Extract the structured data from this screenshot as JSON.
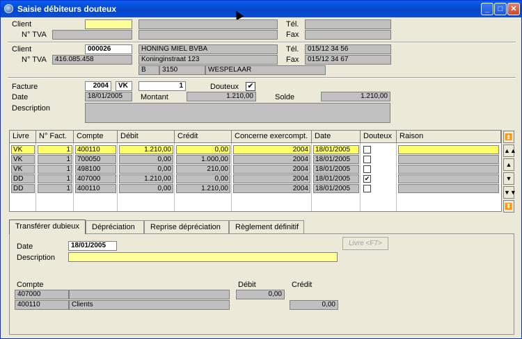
{
  "window": {
    "title": "Saisie débiteurs douteux"
  },
  "search": {
    "client_label": "Client",
    "tva_label": "N° TVA",
    "tel_label": "Tél.",
    "fax_label": "Fax"
  },
  "client": {
    "client_label": "Client",
    "tva_label": "N° TVA",
    "tel_label": "Tél.",
    "fax_label": "Fax",
    "code": "000026",
    "name": "HONING MIEL BVBA",
    "street": "Koninginstraat 123",
    "country": "B",
    "postal": "3150",
    "city": "WESPELAAR",
    "tva": "416.085.458",
    "tel": "015/12 34 56",
    "fax": "015/12 34 67"
  },
  "invoice": {
    "facture_label": "Facture",
    "year": "2004",
    "journal": "VK",
    "number": "1",
    "douteux_label": "Douteux",
    "douteux_checked": "✔",
    "date_label": "Date",
    "date": "18/01/2005",
    "montant_label": "Montant",
    "montant": "1.210,00",
    "solde_label": "Solde",
    "solde": "1.210,00",
    "description_label": "Description"
  },
  "grid": {
    "headers": [
      "Livre",
      "N° Fact.",
      "Compte",
      "Débit",
      "Crédit",
      "Concerne exercompt.",
      "Date",
      "Douteux",
      "Raison"
    ],
    "rows": [
      {
        "livre": "VK",
        "fact": "1",
        "compte": "400110",
        "debit": "1.210,00",
        "credit": "0,00",
        "exercice": "2004",
        "date": "18/01/2005",
        "douteux": "",
        "raison": ""
      },
      {
        "livre": "VK",
        "fact": "1",
        "compte": "700050",
        "debit": "0,00",
        "credit": "1.000,00",
        "exercice": "2004",
        "date": "18/01/2005",
        "douteux": "",
        "raison": ""
      },
      {
        "livre": "VK",
        "fact": "1",
        "compte": "498100",
        "debit": "0,00",
        "credit": "210,00",
        "exercice": "2004",
        "date": "18/01/2005",
        "douteux": "",
        "raison": ""
      },
      {
        "livre": "DD",
        "fact": "1",
        "compte": "407000",
        "debit": "1.210,00",
        "credit": "0,00",
        "exercice": "2004",
        "date": "18/01/2005",
        "douteux": "✔",
        "raison": ""
      },
      {
        "livre": "DD",
        "fact": "1",
        "compte": "400110",
        "debit": "0,00",
        "credit": "1.210,00",
        "exercice": "2004",
        "date": "18/01/2005",
        "douteux": "",
        "raison": ""
      }
    ]
  },
  "tabs": [
    {
      "label": "Transférer dubieux"
    },
    {
      "label": "Dépréciation"
    },
    {
      "label": "Reprise dépréciation"
    },
    {
      "label": "Règlement définitif"
    }
  ],
  "panel": {
    "date_label": "Date",
    "date": "18/01/2005",
    "description_label": "Description",
    "livre_button": "Livre <F7>",
    "compte_label": "Compte",
    "debit_label": "Débit",
    "credit_label": "Crédit",
    "lines": [
      {
        "compte": "407000",
        "name": "",
        "debit": "0,00",
        "credit": ""
      },
      {
        "compte": "400110",
        "name": "Clients",
        "debit": "",
        "credit": "0,00"
      }
    ]
  },
  "colors": {
    "titlebar": "#0a5ff0",
    "highlight": "#ffff99",
    "field": "#c0c0c0"
  }
}
